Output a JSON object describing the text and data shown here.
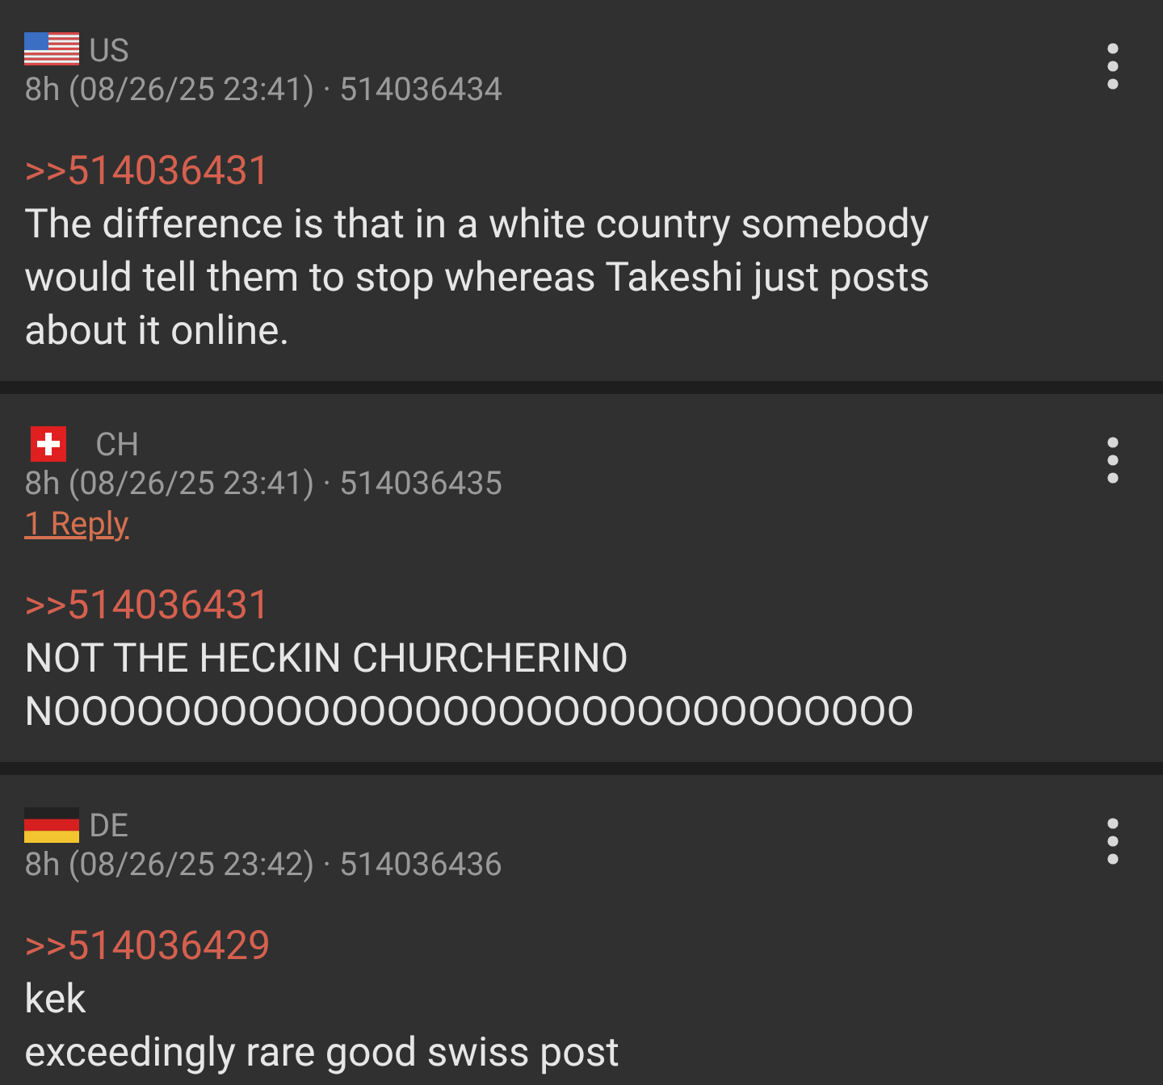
{
  "posts": [
    {
      "flag": {
        "kind": "us"
      },
      "country": "US",
      "meta": "8h (08/26/25 23:41) · 514036434",
      "quote": ">>514036431",
      "lines": [
        "The difference is that in a white country somebody",
        "would tell them to stop whereas Takeshi just posts",
        "about it online."
      ]
    },
    {
      "flag": {
        "kind": "ch"
      },
      "country": "CH",
      "meta": "8h (08/26/25 23:41) · 514036435",
      "replies": "1 Reply",
      "quote": ">>514036431",
      "lines": [
        "NOT THE HECKIN CHURCHERINO",
        "NOOOOOOOOOOOOOOOOOOOOOOOOOOOOOOO"
      ]
    },
    {
      "flag": {
        "kind": "de"
      },
      "country": "DE",
      "meta": "8h (08/26/25 23:42) · 514036436",
      "quote": ">>514036429",
      "lines": [
        "kek",
        "exceedingly rare good swiss post"
      ]
    }
  ]
}
